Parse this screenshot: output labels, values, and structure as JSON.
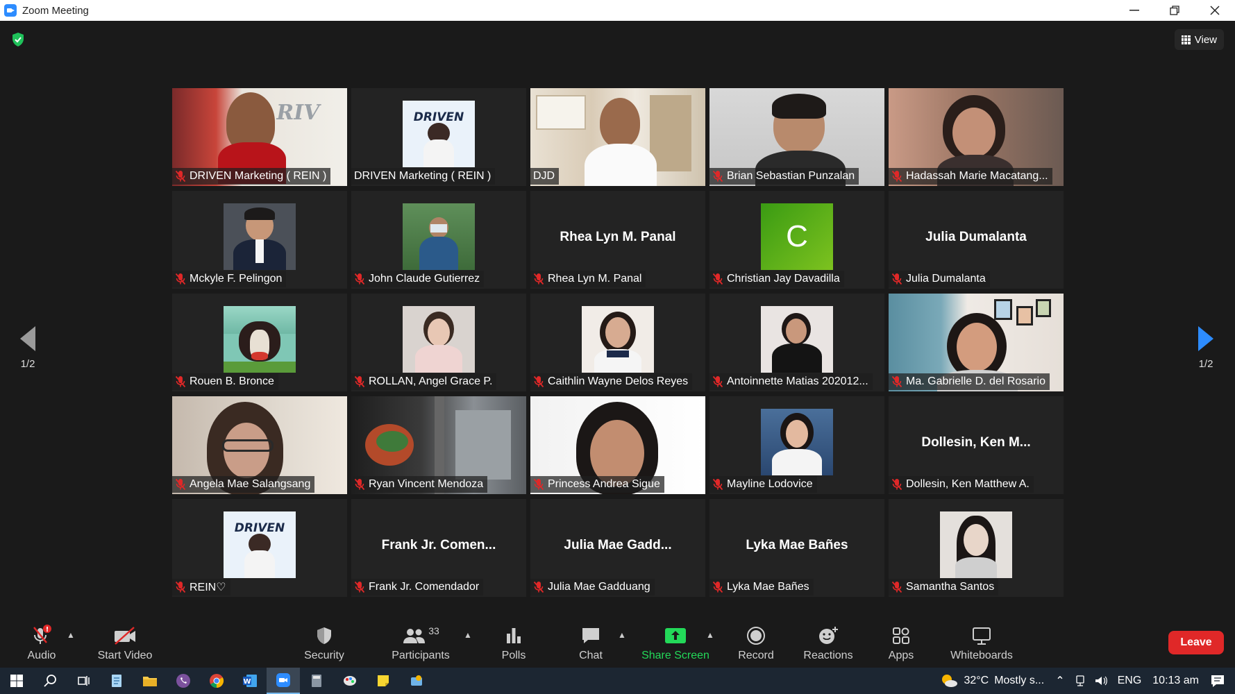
{
  "window": {
    "title": "Zoom Meeting"
  },
  "top": {
    "view_label": "View"
  },
  "pager": {
    "left": "1/2",
    "right": "1/2"
  },
  "participants": [
    {
      "name": "DRIVEN Marketing ( REIN )",
      "type": "video",
      "muted": true
    },
    {
      "name": "DRIVEN Marketing ( REIN )",
      "type": "thumb",
      "muted": false
    },
    {
      "name": "DJD",
      "type": "video",
      "muted": false,
      "speaking": true
    },
    {
      "name": "Brian Sebastian Punzalan",
      "type": "video",
      "muted": true
    },
    {
      "name": "Hadassah Marie Macatang...",
      "type": "video",
      "muted": true
    },
    {
      "name": "Mckyle F. Pelingon",
      "type": "thumb",
      "muted": true
    },
    {
      "name": "John Claude Gutierrez",
      "type": "thumb",
      "muted": true
    },
    {
      "name": "Rhea Lyn M. Panal",
      "type": "name",
      "big": "Rhea Lyn M. Panal",
      "muted": true
    },
    {
      "name": "Christian Jay Davadilla",
      "type": "avatar",
      "letter": "C",
      "muted": true
    },
    {
      "name": "Julia Dumalanta",
      "type": "name",
      "big": "Julia Dumalanta",
      "muted": true
    },
    {
      "name": "Rouen B. Bronce",
      "type": "thumb",
      "muted": true
    },
    {
      "name": "ROLLAN, Angel Grace P.",
      "type": "thumb",
      "muted": true
    },
    {
      "name": "Caithlin Wayne Delos Reyes",
      "type": "thumb",
      "muted": true
    },
    {
      "name": "Antoinnette Matias 202012...",
      "type": "thumb",
      "muted": true
    },
    {
      "name": "Ma. Gabrielle D. del Rosario",
      "type": "video",
      "muted": true
    },
    {
      "name": "Angela Mae Salangsang",
      "type": "video",
      "muted": true
    },
    {
      "name": "Ryan Vincent Mendoza",
      "type": "video",
      "muted": true
    },
    {
      "name": "Princess Andrea Sigue",
      "type": "video",
      "muted": true
    },
    {
      "name": "Mayline Lodovice",
      "type": "thumb",
      "muted": true
    },
    {
      "name": "Dollesin, Ken Matthew A.",
      "type": "name",
      "big": "Dollesin,  Ken  M...",
      "muted": true
    },
    {
      "name": "REIN♡",
      "type": "thumb",
      "muted": true
    },
    {
      "name": "Frank Jr. Comendador",
      "type": "name",
      "big": "Frank  Jr.  Comen...",
      "muted": true
    },
    {
      "name": "Julia Mae Gadduang",
      "type": "name",
      "big": "Julia  Mae  Gadd...",
      "muted": true
    },
    {
      "name": "Lyka Mae Bañes",
      "type": "name",
      "big": "Lyka Mae Bañes",
      "muted": true
    },
    {
      "name": "Samantha Santos",
      "type": "thumb",
      "muted": true
    }
  ],
  "toolbar": {
    "audio": "Audio",
    "start_video": "Start Video",
    "security": "Security",
    "participants": "Participants",
    "participants_count": "33",
    "polls": "Polls",
    "chat": "Chat",
    "share_screen": "Share Screen",
    "record": "Record",
    "reactions": "Reactions",
    "apps": "Apps",
    "whiteboards": "Whiteboards",
    "leave": "Leave",
    "audio_alert": "!"
  },
  "taskbar": {
    "temperature": "32°C",
    "weather": "Mostly s...",
    "language": "ENG",
    "time": "10:13 am"
  },
  "colors": {
    "speaker_border": "#d6e64a",
    "accent_blue": "#2d8cff",
    "share_green": "#23d959",
    "leave_red": "#e02828",
    "mute_red": "#e02828"
  }
}
